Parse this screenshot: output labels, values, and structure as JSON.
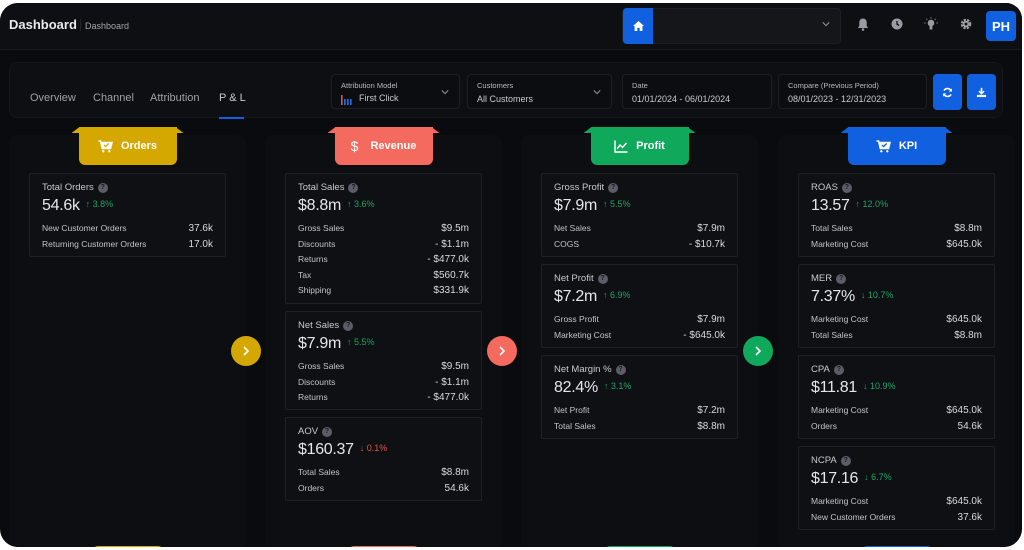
{
  "header": {
    "app_title": "Dashboard",
    "breadcrumb": "Dashboard",
    "store_select_value": "",
    "avatar_initials": "PH"
  },
  "colors": {
    "primary": "#1160e0",
    "orders": "#d4a800",
    "revenue": "#f46a5e",
    "profit": "#10a85a",
    "kpi": "#1160e0",
    "positive": "#1fa463",
    "negative": "#e5534b"
  },
  "tabs": [
    {
      "label": "Overview",
      "active": false
    },
    {
      "label": "Channel",
      "active": false
    },
    {
      "label": "Attribution",
      "active": false
    },
    {
      "label": "P & L",
      "active": true
    }
  ],
  "filters": {
    "attribution_model": {
      "label": "Attribution Model",
      "value": "First Click"
    },
    "customers": {
      "label": "Customers",
      "value": "All Customers"
    },
    "date": {
      "label": "Date",
      "value": "01/01/2024 - 06/01/2024"
    },
    "compare": {
      "label": "Compare (Previous Period)",
      "value": "08/01/2023 - 12/31/2023"
    }
  },
  "columns": [
    {
      "title": "Orders",
      "icon": "cart-check-icon",
      "cards": [
        {
          "title": "Total Orders",
          "value": "54.6k",
          "delta": "↑ 3.8%",
          "trend": "up",
          "rows": [
            {
              "label": "New Customer Orders",
              "value": "37.6k"
            },
            {
              "label": "Returning Customer Orders",
              "value": "17.0k"
            }
          ]
        }
      ]
    },
    {
      "title": "Revenue",
      "icon": "dollar-icon",
      "cards": [
        {
          "title": "Total Sales",
          "value": "$8.8m",
          "delta": "↑ 3.6%",
          "trend": "up",
          "rows": [
            {
              "label": "Gross Sales",
              "value": "$9.5m"
            },
            {
              "label": "Discounts",
              "value": "- $1.1m"
            },
            {
              "label": "Returns",
              "value": "- $477.0k"
            },
            {
              "label": "Tax",
              "value": "$560.7k"
            },
            {
              "label": "Shipping",
              "value": "$331.9k"
            }
          ]
        },
        {
          "title": "Net Sales",
          "value": "$7.9m",
          "delta": "↑ 5.5%",
          "trend": "up",
          "rows": [
            {
              "label": "Gross Sales",
              "value": "$9.5m"
            },
            {
              "label": "Discounts",
              "value": "- $1.1m"
            },
            {
              "label": "Returns",
              "value": "- $477.0k"
            }
          ]
        },
        {
          "title": "AOV",
          "value": "$160.37",
          "delta": "↓ 0.1%",
          "trend": "down",
          "rows": [
            {
              "label": "Total Sales",
              "value": "$8.8m"
            },
            {
              "label": "Orders",
              "value": "54.6k"
            }
          ]
        }
      ]
    },
    {
      "title": "Profit",
      "icon": "line-chart-icon",
      "cards": [
        {
          "title": "Gross Profit",
          "value": "$7.9m",
          "delta": "↑ 5.5%",
          "trend": "up",
          "rows": [
            {
              "label": "Net Sales",
              "value": "$7.9m"
            },
            {
              "label": "COGS",
              "value": "- $10.7k"
            }
          ]
        },
        {
          "title": "Net Profit",
          "value": "$7.2m",
          "delta": "↑ 6.9%",
          "trend": "up",
          "rows": [
            {
              "label": "Gross Profit",
              "value": "$7.9m"
            },
            {
              "label": "Marketing Cost",
              "value": "- $645.0k"
            }
          ]
        },
        {
          "title": "Net Margin %",
          "value": "82.4%",
          "delta": "↑ 3.1%",
          "trend": "up",
          "rows": [
            {
              "label": "Net Profit",
              "value": "$7.2m"
            },
            {
              "label": "Total Sales",
              "value": "$8.8m"
            }
          ]
        }
      ]
    },
    {
      "title": "KPI",
      "icon": "cart-check-icon",
      "cards": [
        {
          "title": "ROAS",
          "value": "13.57",
          "delta": "↑ 12.0%",
          "trend": "up",
          "rows": [
            {
              "label": "Total Sales",
              "value": "$8.8m"
            },
            {
              "label": "Marketing Cost",
              "value": "$645.0k"
            }
          ]
        },
        {
          "title": "MER",
          "value": "7.37%",
          "delta": "↓ 10.7%",
          "trend": "down-good",
          "rows": [
            {
              "label": "Marketing Cost",
              "value": "$645.0k"
            },
            {
              "label": "Total Sales",
              "value": "$8.8m"
            }
          ]
        },
        {
          "title": "CPA",
          "value": "$11.81",
          "delta": "↓ 10.9%",
          "trend": "down-good",
          "rows": [
            {
              "label": "Marketing Cost",
              "value": "$645.0k"
            },
            {
              "label": "Orders",
              "value": "54.6k"
            }
          ]
        },
        {
          "title": "NCPA",
          "value": "$17.16",
          "delta": "↓ 6.7%",
          "trend": "down-good",
          "rows": [
            {
              "label": "Marketing Cost",
              "value": "$645.0k"
            },
            {
              "label": "New Customer Orders",
              "value": "37.6k"
            }
          ]
        }
      ]
    }
  ]
}
